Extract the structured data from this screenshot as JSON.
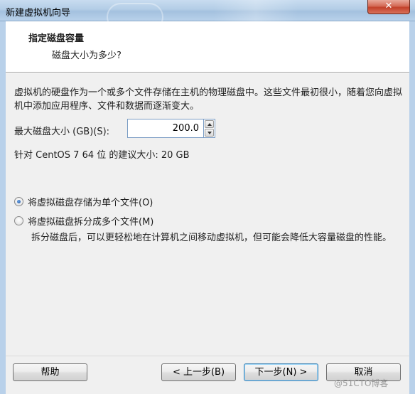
{
  "window": {
    "title": "新建虚拟机向导",
    "close_label": "✕"
  },
  "header": {
    "title": "指定磁盘容量",
    "subtitle": "磁盘大小为多少?"
  },
  "content": {
    "description": "虚拟机的硬盘作为一个或多个文件存储在主机的物理磁盘中。这些文件最初很小，随着您向虚拟机中添加应用程序、文件和数据而逐渐变大。",
    "max_size_label": "最大磁盘大小 (GB)(S):",
    "max_size_value": "200.0",
    "recommended": "针对 CentOS 7 64 位 的建议大小: 20 GB",
    "options": [
      {
        "label": "将虚拟磁盘存储为单个文件(O)",
        "checked": true
      },
      {
        "label": "将虚拟磁盘拆分成多个文件(M)",
        "checked": false
      }
    ],
    "split_description": "拆分磁盘后，可以更轻松地在计算机之间移动虚拟机，但可能会降低大容量磁盘的性能。"
  },
  "footer": {
    "help": "帮助",
    "back": "< 上一步(B)",
    "next": "下一步(N) >",
    "cancel": "取消"
  },
  "watermark": "@51CTO博客"
}
